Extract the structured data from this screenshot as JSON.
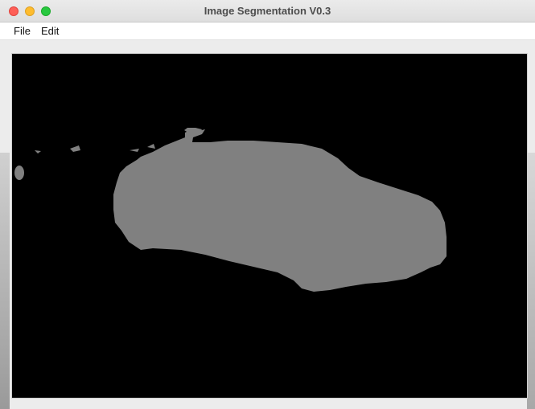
{
  "window": {
    "title": "Image Segmentation V0.3",
    "controls": [
      "close",
      "minimize",
      "zoom"
    ]
  },
  "menubar": {
    "items": [
      {
        "label": "File"
      },
      {
        "label": "Edit"
      }
    ]
  },
  "canvas": {
    "background_color": "#000000",
    "segment_color": "#808080",
    "description_icon": "segmentation-mask"
  },
  "colors": {
    "close": "#fe5f57",
    "minimize": "#febc2e",
    "zoom": "#28c840"
  }
}
